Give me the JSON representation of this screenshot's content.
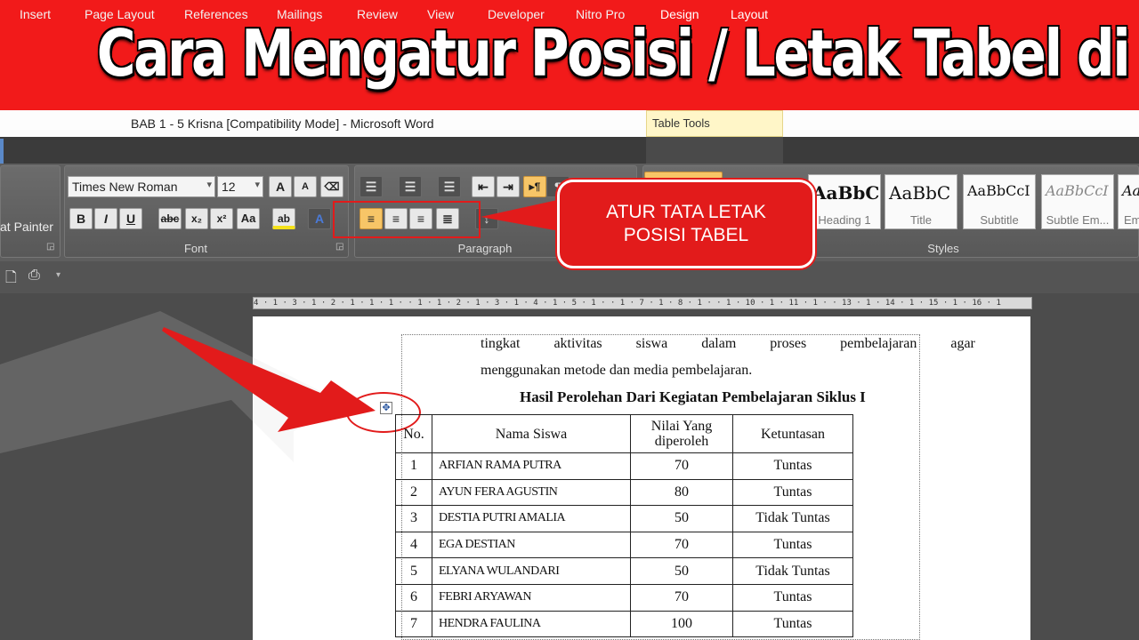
{
  "banner": {
    "title": "Cara Mengatur Posisi / Letak Tabel di MS. Word"
  },
  "window": {
    "title": "BAB  1 - 5 Krisna [Compatibility Mode] - Microsoft Word",
    "context_tab_group": "Table Tools"
  },
  "tabs": [
    "Insert",
    "Page Layout",
    "References",
    "Mailings",
    "Review",
    "View",
    "Developer",
    "Nitro Pro",
    "Design",
    "Layout"
  ],
  "ribbon": {
    "clipboard": {
      "format_painter_label": "at Painter"
    },
    "font": {
      "name": "Times New Roman",
      "size": "12",
      "group_label": "Font",
      "buttons": {
        "bold": "B",
        "italic": "I",
        "underline": "U",
        "strike": "abc",
        "subscript": "x₂",
        "superscript": "x²",
        "change_case": "Aa",
        "grow": "A",
        "shrink": "A",
        "font_color": "A",
        "highlight": "ab"
      }
    },
    "paragraph": {
      "group_label": "Paragraph"
    },
    "styles": {
      "group_label": "Styles",
      "items": [
        {
          "preview": "AaBbC",
          "name": "Heading 1"
        },
        {
          "preview": "AaBbC",
          "name": "Title"
        },
        {
          "preview": "AaBbCcI",
          "name": "Subtitle"
        },
        {
          "preview": "AaBbCcI",
          "name": "Subtle Em..."
        },
        {
          "preview": "Aa",
          "name": "Em"
        }
      ]
    }
  },
  "callout": {
    "line1": "ATUR TATA LETAK",
    "line2": "POSISI TABEL"
  },
  "document": {
    "line1": "tingkat aktivitas siswa dalam proses pembelajaran agar",
    "line2": "menggunakan metode dan media pembelajaran.",
    "table_title": "Hasil Perolehan Dari Kegiatan Pembelajaran  Siklus I",
    "table": {
      "headers": {
        "no": "No.",
        "name": "Nama Siswa",
        "nilai_1": "Nilai Yang",
        "nilai_2": "diperoleh",
        "ket": "Ketuntasan"
      },
      "rows": [
        {
          "no": "1",
          "name": "ARFIAN RAMA PUTRA",
          "nilai": "70",
          "ket": "Tuntas"
        },
        {
          "no": "2",
          "name": "AYUN FERA  AGUSTIN",
          "nilai": "80",
          "ket": "Tuntas"
        },
        {
          "no": "3",
          "name": "DESTIA PUTRI AMALIA",
          "nilai": "50",
          "ket": "Tidak Tuntas"
        },
        {
          "no": "4",
          "name": "EGA DESTIAN",
          "nilai": "70",
          "ket": "Tuntas"
        },
        {
          "no": "5",
          "name": "ELYANA WULANDARI",
          "nilai": "50",
          "ket": "Tidak Tuntas"
        },
        {
          "no": "6",
          "name": "FEBRI ARYAWAN",
          "nilai": "70",
          "ket": "Tuntas"
        },
        {
          "no": "7",
          "name": "HENDRA FAULINA",
          "nilai": "100",
          "ket": "Tuntas"
        }
      ]
    }
  },
  "ruler": {
    "text": "4 · 1 · 3 · 1 · 2 · 1 · 1 · 1 ·  · 1 · 1 · 2 · 1 · 3 · 1 · 4 · 1 · 5 · 1 ·  · 1 · 7 · 1 · 8 · 1 ·  · 1 · 10 · 1 · 11 · 1 ·  · 13 · 1 · 14 · 1 · 15 · 1 · 16 · 1"
  },
  "colors": {
    "banner": "#f21a1a",
    "callout": "#e21b1b",
    "ribbon": "#5e5e5e",
    "tabbar": "#3b3b3b"
  }
}
